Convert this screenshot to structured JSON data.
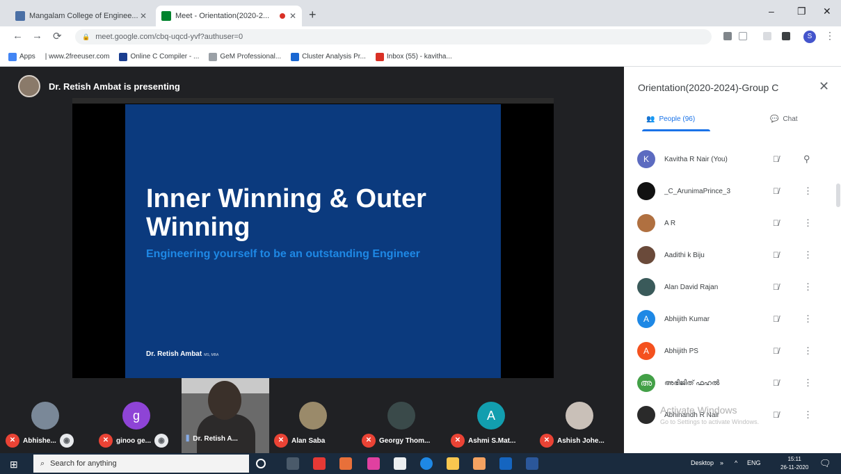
{
  "browser": {
    "tabs": [
      {
        "title": "Mangalam College of Enginee...",
        "favicon_color": "#4a6fa5",
        "active": false
      },
      {
        "title": "Meet - Orientation(2020-2...",
        "favicon_color": "#00832d",
        "active": true,
        "recording": true
      }
    ],
    "new_tab_icon": "plus-icon",
    "window_controls": {
      "minimize": "–",
      "maximize": "❐",
      "close": "✕"
    },
    "nav": {
      "back": "←",
      "forward": "→",
      "reload": "⟳"
    },
    "url": "meet.google.com/cbq-uqcd-yvf?authuser=0",
    "profile_initial": "S",
    "bookmarks": [
      {
        "label": "Apps",
        "color": "#4285f4"
      },
      {
        "label": "| www.2freeuser.com",
        "color": "#fbbc04"
      },
      {
        "label": "Online C Compiler - ...",
        "color": "#1a3d8f"
      },
      {
        "label": "GeM Professional...",
        "color": "#9aa0a6"
      },
      {
        "label": "Cluster Analysis Pr...",
        "color": "#1967d2"
      },
      {
        "label": "Inbox (55) - kavitha...",
        "color": "#d93025"
      }
    ]
  },
  "meet": {
    "presenter_banner": "Dr. Retish Ambat is presenting",
    "slide": {
      "title": "Inner Winning & Outer Winning",
      "subtitle": "Engineering yourself to be an outstanding Engineer",
      "author": "Dr. Retish Ambat",
      "author_suffix": "MS, MBA"
    },
    "filmstrip": [
      {
        "name": "Abhishe...",
        "avatar_color": "#7a8898",
        "avatar_letter": "",
        "muted": true,
        "cam_icon": true
      },
      {
        "name": "ginoo ge...",
        "avatar_color": "#8e44d6",
        "avatar_letter": "g",
        "muted": true,
        "cam_icon": true
      },
      {
        "name": "Dr. Retish A...",
        "video": true,
        "speaking": true
      },
      {
        "name": "Alan Saba",
        "avatar_color": "#9a8a6a",
        "avatar_letter": "",
        "muted": true
      },
      {
        "name": "Georgy Thom...",
        "avatar_color": "#3a4a4a",
        "avatar_letter": "",
        "muted": true
      },
      {
        "name": "Ashmi S.Mat...",
        "avatar_color": "#129eaf",
        "avatar_letter": "A",
        "muted": true
      },
      {
        "name": "Ashish Johe...",
        "avatar_color": "#c9c0b8",
        "avatar_letter": "",
        "muted": true
      }
    ]
  },
  "panel": {
    "title": "Orientation(2020-2024)-Group C",
    "close_icon": "✕",
    "tabs": {
      "people": "People (96)",
      "chat": "Chat"
    },
    "participants": [
      {
        "name": "Kavitha R Nair (You)",
        "color": "#5c6bc0",
        "letter": "K",
        "pin": true
      },
      {
        "name": "_C_ArunimaPrince_3",
        "color": "#111111",
        "letter": ""
      },
      {
        "name": "A R",
        "color": "#b07040",
        "letter": ""
      },
      {
        "name": "Aadithi k Biju",
        "color": "#6a4a3a",
        "letter": ""
      },
      {
        "name": "Alan David Rajan",
        "color": "#3a5a5a",
        "letter": ""
      },
      {
        "name": "Abhijith Kumar",
        "color": "#1e88e5",
        "letter": "A"
      },
      {
        "name": "Abhijith PS",
        "color": "#f4511e",
        "letter": "A"
      },
      {
        "name": "അഭിജിത് ഫഹൽ",
        "color": "#43a047",
        "letter": "അ"
      },
      {
        "name": "Abhinandh R Nair",
        "color": "#2a2a2a",
        "letter": ""
      }
    ],
    "watermark_title": "Activate Windows",
    "watermark_sub": "Go to Settings to activate Windows."
  },
  "taskbar": {
    "search_placeholder": "Search for anything",
    "desktop_label": "Desktop",
    "lang": "ENG",
    "time": "15:11",
    "date": "26-11-2020"
  }
}
